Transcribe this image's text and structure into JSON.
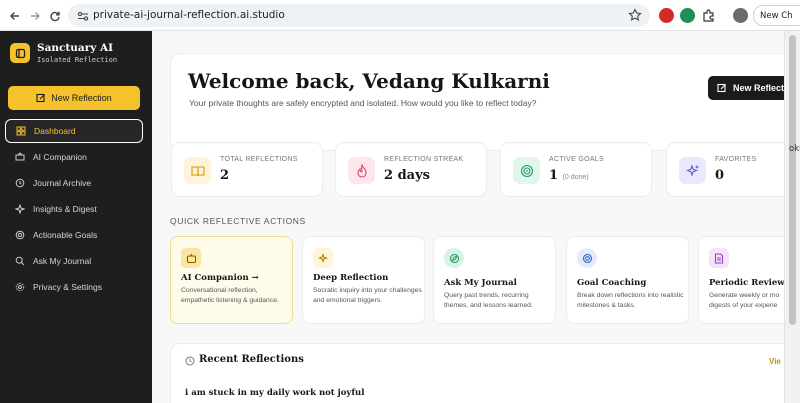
{
  "browser": {
    "url": "private-ai-journal-reflection.ai.studio",
    "profile_button": "New Ch",
    "edge_fragment": "okr"
  },
  "sidebar": {
    "brand_name": "Sanctuary AI",
    "brand_sub": "Isolated Reflection",
    "new_button": "New Reflection",
    "items": [
      {
        "label": "Dashboard",
        "icon": "grid-icon",
        "active": true
      },
      {
        "label": "AI Companion",
        "icon": "chat-icon"
      },
      {
        "label": "Journal Archive",
        "icon": "history-icon"
      },
      {
        "label": "Insights & Digest",
        "icon": "sparkle-icon"
      },
      {
        "label": "Actionable Goals",
        "icon": "target-icon"
      },
      {
        "label": "Ask My Journal",
        "icon": "search-icon"
      },
      {
        "label": "Privacy & Settings",
        "icon": "gear-icon"
      }
    ]
  },
  "welcome": {
    "title": "Welcome back, Vedang Kulkarni",
    "subtitle": "Your private thoughts are safely encrypted and isolated. How would you like to reflect today?",
    "button": "New Reflecti"
  },
  "stats": [
    {
      "label": "TOTAL REFLECTIONS",
      "value": "2",
      "note": "",
      "icon": "book-icon",
      "color": "#fff3d9"
    },
    {
      "label": "REFLECTION STREAK",
      "value": "2 days",
      "note": "",
      "icon": "flame-icon",
      "color": "#ffe6ec"
    },
    {
      "label": "ACTIVE GOALS",
      "value": "1",
      "note": "(0 done)",
      "icon": "target-icon",
      "color": "#e1f6ec"
    },
    {
      "label": "FAVORITES",
      "value": "0",
      "note": "",
      "icon": "sparkle-icon",
      "color": "#e9e9fb"
    }
  ],
  "quick_actions": {
    "heading": "QUICK REFLECTIVE ACTIONS",
    "items": [
      {
        "title": "AI Companion →",
        "desc": "Conversational reflection, empathetic listening & guidance.",
        "icon": "bot-icon"
      },
      {
        "title": "Deep Reflection",
        "desc": "Socratic inquiry into your challenges and emotional triggers.",
        "icon": "sparkle-icon"
      },
      {
        "title": "Ask My Journal",
        "desc": "Query past trends, recurring themes, and lessons learned.",
        "icon": "compass-icon"
      },
      {
        "title": "Goal Coaching",
        "desc": "Break down reflections into realistic milestones & tasks.",
        "icon": "target-icon"
      },
      {
        "title": "Periodic Review",
        "desc": "Generate weekly or mo digests of your experie",
        "icon": "document-icon"
      }
    ]
  },
  "recent": {
    "title": "Recent Reflections",
    "view_all": "Vie",
    "entries": [
      {
        "title": "i am stuck in my daily work not joyful"
      }
    ]
  }
}
